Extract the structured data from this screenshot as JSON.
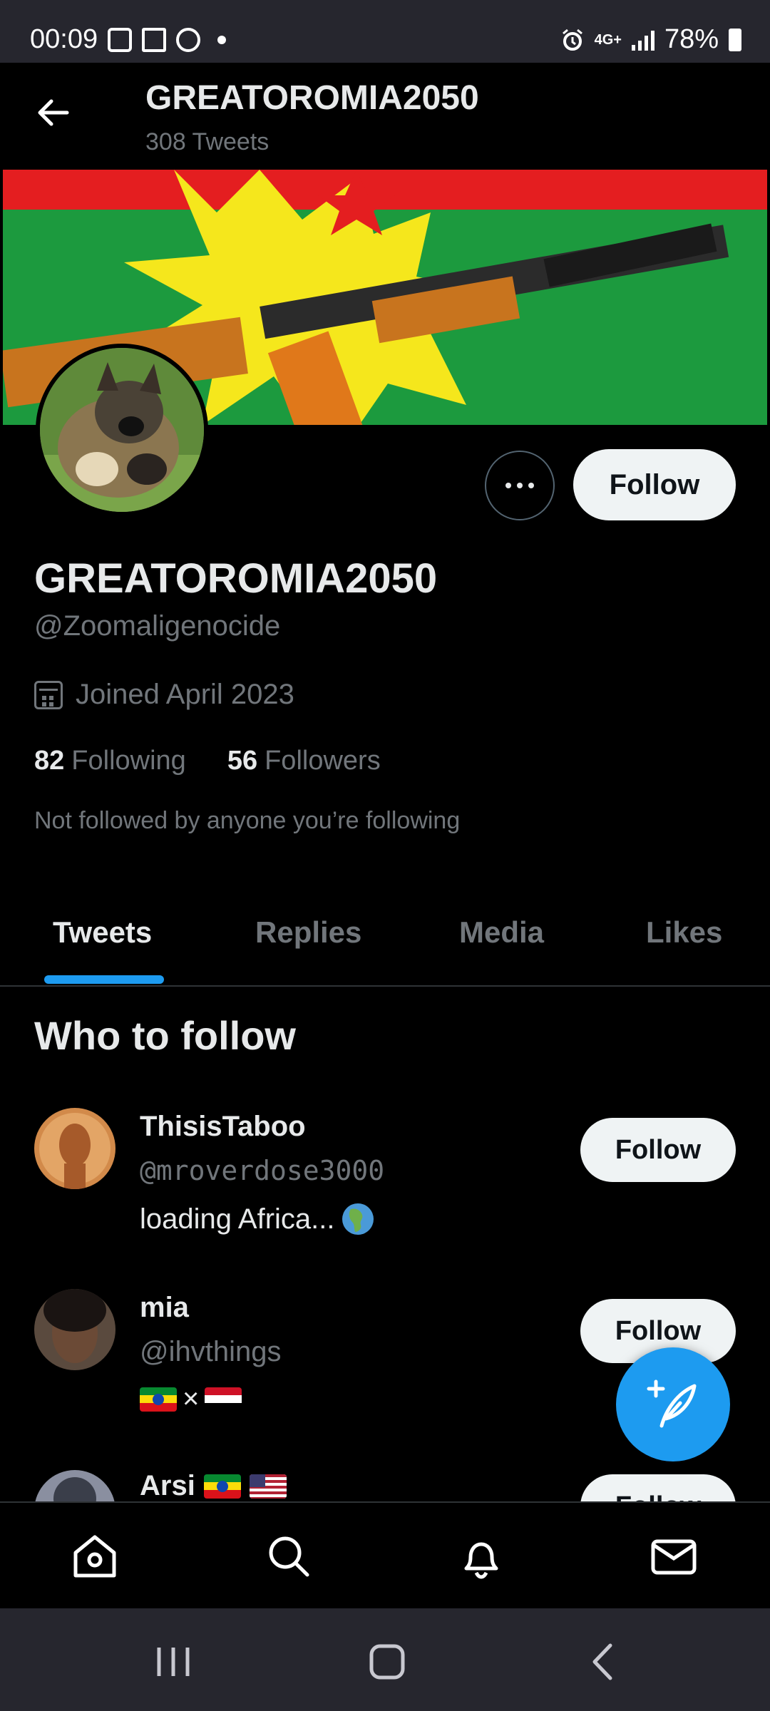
{
  "status_bar": {
    "time": "00:09",
    "network": "4G+",
    "battery": "78%"
  },
  "header": {
    "title": "GREATOROMIA2050",
    "subtitle": "308 Tweets"
  },
  "profile": {
    "display_name": "GREATOROMIA2050",
    "handle": "@Zoomaligenocide",
    "joined": "Joined April 2023",
    "following_count": "82",
    "following_label": "Following",
    "followers_count": "56",
    "followers_label": "Followers",
    "mutuals_note": "Not followed by anyone you’re following",
    "follow_label": "Follow"
  },
  "tabs": [
    {
      "label": "Tweets",
      "active": true
    },
    {
      "label": "Replies",
      "active": false
    },
    {
      "label": "Media",
      "active": false
    },
    {
      "label": "Likes",
      "active": false
    }
  ],
  "who_to_follow": {
    "title": "Who to follow",
    "accounts": [
      {
        "name": "ThisisTaboo",
        "handle": "@mroverdose3000",
        "bio": "loading Africa...",
        "follow_label": "Follow"
      },
      {
        "name": "mia",
        "handle": "@ihvthings",
        "bio": "×",
        "follow_label": "Follow"
      },
      {
        "name": "Arsi",
        "handle": "",
        "bio": "",
        "follow_label": "Follow"
      }
    ]
  },
  "colors": {
    "accent": "#1d9bf0",
    "background": "#000000",
    "secondary_text": "#71767b"
  },
  "icons": {
    "nav": [
      "home-icon",
      "search-icon",
      "notifications-icon",
      "messages-icon"
    ],
    "fab": "compose-tweet-icon"
  }
}
